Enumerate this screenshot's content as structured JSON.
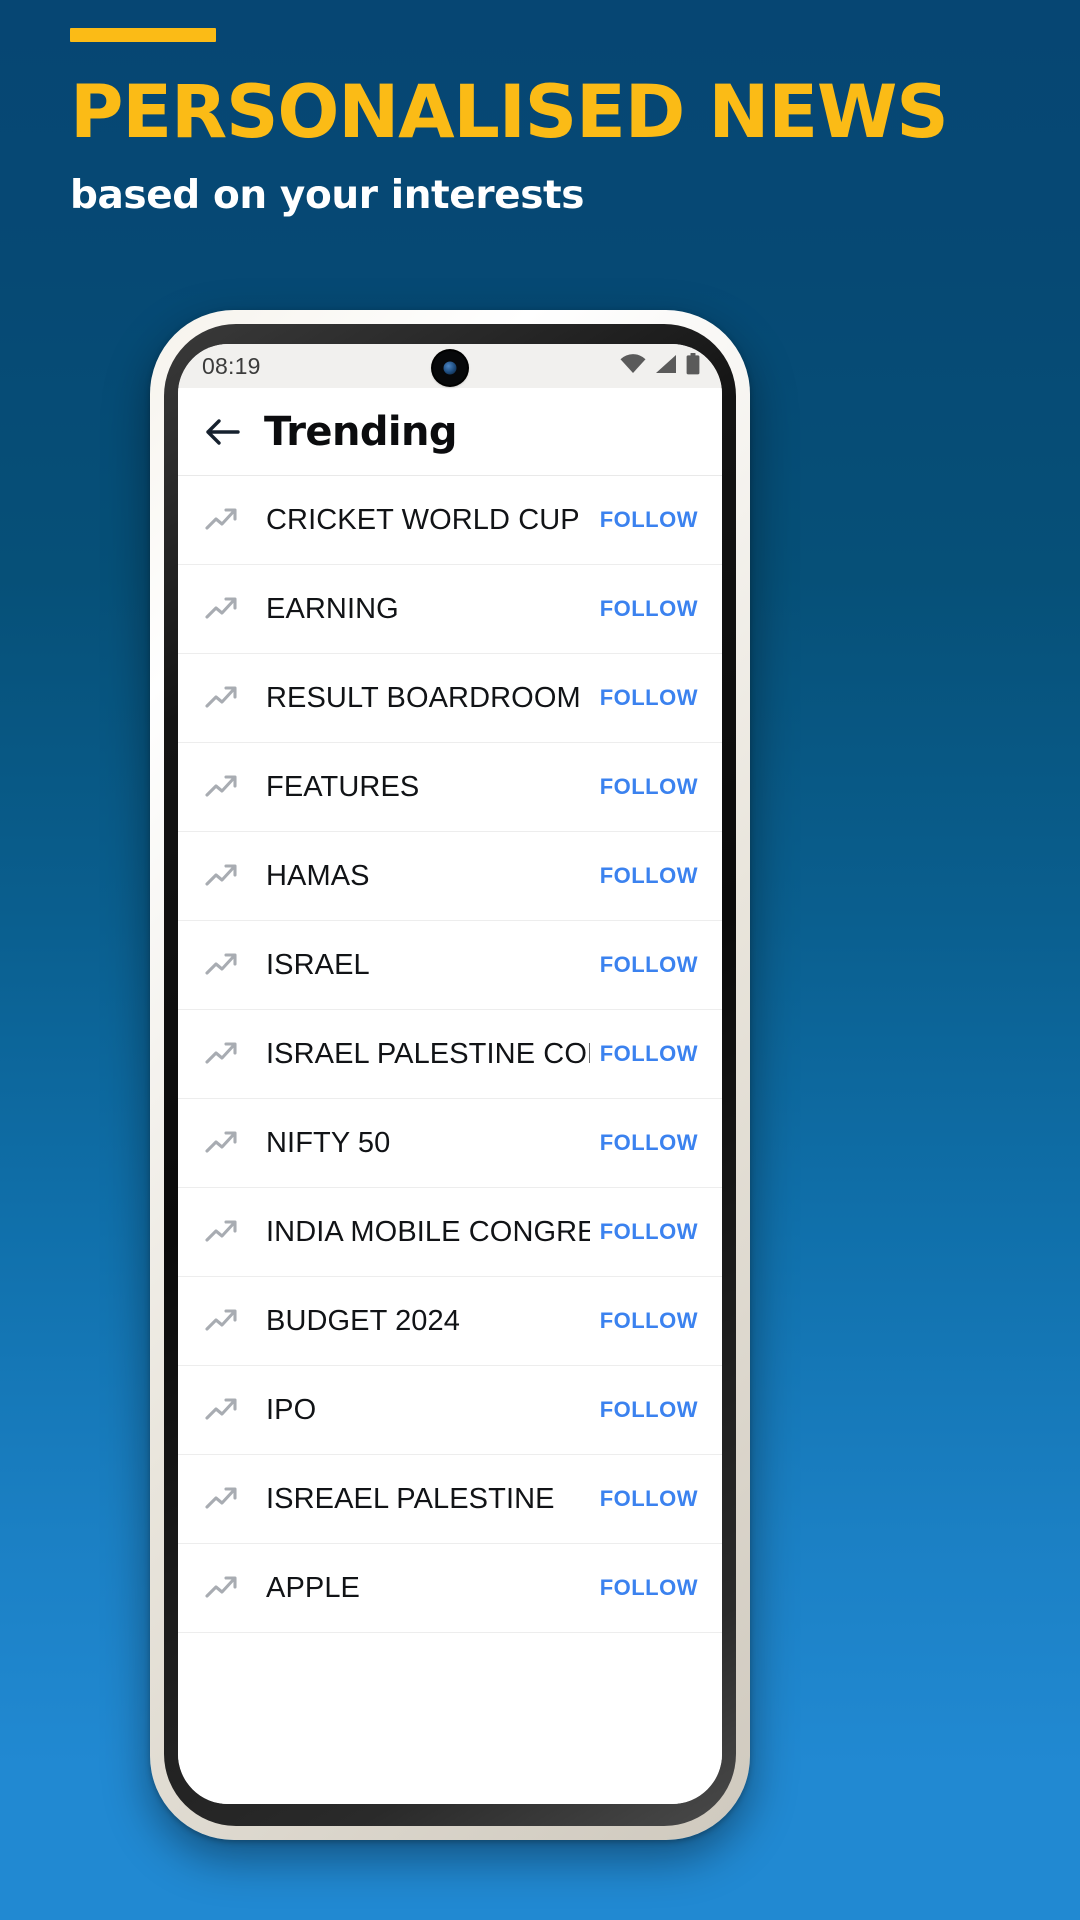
{
  "promo": {
    "title": "PERSONALISED NEWS",
    "subtitle": "based on your interests",
    "accent_color": "#FBBB16",
    "text_color": "#FFFFFF",
    "background_top_color": "#064673",
    "background_bottom_color": "#2189D2"
  },
  "phone": {
    "statusbar": {
      "time": "08:19",
      "icons": [
        "wifi-icon",
        "cellular-signal-icon",
        "battery-icon"
      ]
    },
    "appbar": {
      "back_icon": "back-arrow-icon",
      "title": "Trending"
    },
    "list": {
      "follow_label": "FOLLOW",
      "follow_color": "#3B82EF",
      "row_icon": "trending-up-icon",
      "items": [
        {
          "label": "CRICKET WORLD CUP",
          "action": "FOLLOW"
        },
        {
          "label": "EARNING",
          "action": "FOLLOW"
        },
        {
          "label": "RESULT BOARDROOM",
          "action": "FOLLOW"
        },
        {
          "label": "FEATURES",
          "action": "FOLLOW"
        },
        {
          "label": "HAMAS",
          "action": "FOLLOW"
        },
        {
          "label": "ISRAEL",
          "action": "FOLLOW"
        },
        {
          "label": "ISRAEL PALESTINE CONFLICT",
          "action": "FOLLOW"
        },
        {
          "label": "NIFTY 50",
          "action": "FOLLOW"
        },
        {
          "label": "INDIA MOBILE CONGRESS",
          "action": "FOLLOW"
        },
        {
          "label": "BUDGET 2024",
          "action": "FOLLOW"
        },
        {
          "label": "IPO",
          "action": "FOLLOW"
        },
        {
          "label": "ISREAEL PALESTINE",
          "action": "FOLLOW"
        },
        {
          "label": "APPLE",
          "action": "FOLLOW"
        }
      ]
    }
  }
}
